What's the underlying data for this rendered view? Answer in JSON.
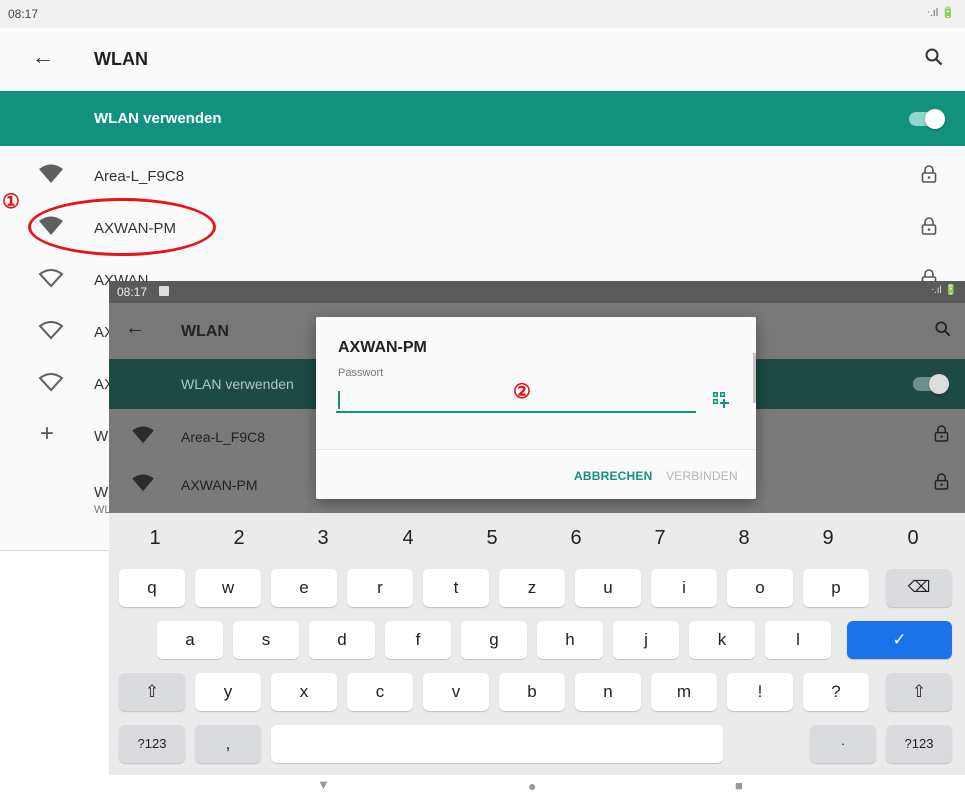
{
  "background_screen": {
    "status": {
      "time": "08:17",
      "signal": "ᐧ.ıl 🔋"
    },
    "appbar": {
      "back": "←",
      "title": "WLAN"
    },
    "toggle_label": "WLAN verwenden",
    "networks": [
      {
        "name": "Area-L_F9C8",
        "signal": "full"
      },
      {
        "name": "AXWAN-PM",
        "signal": "full"
      },
      {
        "name": "AXWAN",
        "signal": "outline"
      },
      {
        "name": "AX",
        "signal": "outline"
      },
      {
        "name": "AX",
        "signal": "outline"
      }
    ],
    "add_network": {
      "icon": "+",
      "label": "W"
    },
    "prefs": {
      "title": "W",
      "subtitle": "WL"
    }
  },
  "annotations": {
    "step1": "①",
    "step2": "②"
  },
  "overlay_screen": {
    "status": {
      "time": "08:17",
      "signal": "ᐧ.ıl 🔋"
    },
    "appbar": {
      "back": "←",
      "title": "WLAN"
    },
    "toggle_label": "WLAN verwenden",
    "networks": [
      {
        "name": "Area-L_F9C8"
      },
      {
        "name": "AXWAN-PM"
      }
    ],
    "dialog": {
      "title": "AXWAN-PM",
      "password_label": "Passwort",
      "password_value": "",
      "cancel": "ABBRECHEN",
      "connect": "VERBINDEN"
    }
  },
  "keyboard": {
    "numbers": [
      "1",
      "2",
      "3",
      "4",
      "5",
      "6",
      "7",
      "8",
      "9",
      "0"
    ],
    "row1": [
      "q",
      "w",
      "e",
      "r",
      "t",
      "z",
      "u",
      "i",
      "o",
      "p"
    ],
    "row2": [
      "a",
      "s",
      "d",
      "f",
      "g",
      "h",
      "j",
      "k",
      "l"
    ],
    "row3": [
      "y",
      "x",
      "c",
      "v",
      "b",
      "n",
      "m",
      "!",
      "?"
    ],
    "backspace": "⌫",
    "enter": "✓",
    "shift": "⇧",
    "symbols_left": "?123",
    "comma": ",",
    "period": "·",
    "symbols_right": "?123"
  },
  "navbar": {
    "back": "▼",
    "home": "●",
    "recents": "■"
  },
  "colors": {
    "accent": "#12917f",
    "annotation": "#e8141b",
    "enter_key": "#1a73e8"
  }
}
